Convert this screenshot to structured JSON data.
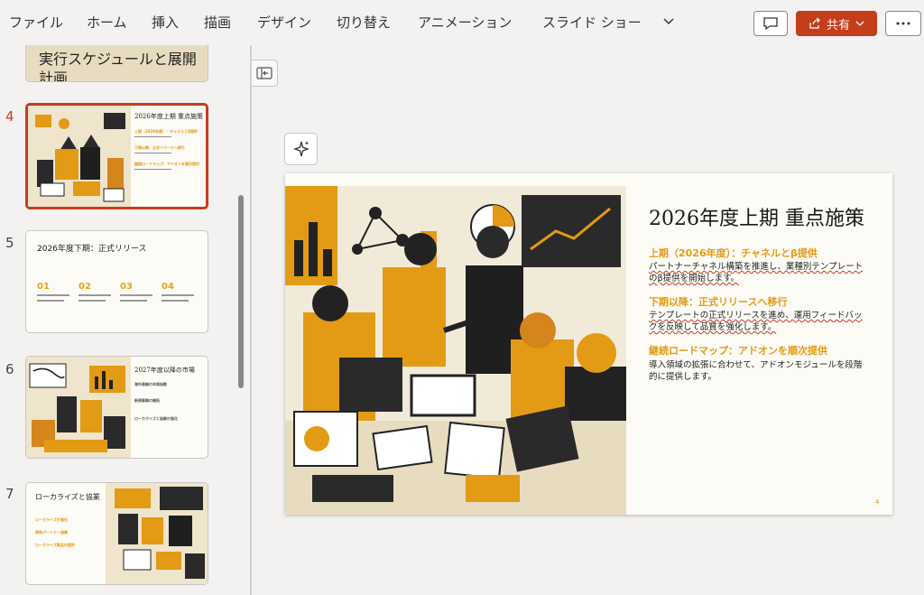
{
  "ribbon": {
    "tabs": [
      "ファイル",
      "ホーム",
      "挿入",
      "描画",
      "デザイン",
      "切り替え",
      "アニメーション",
      "スライド ショー"
    ],
    "share_label": "共有",
    "accent": "#c43e1c"
  },
  "panel": {
    "slide3_partial_title": "実行スケジュールと展開計画",
    "thumbs": [
      {
        "number": "4",
        "title": "2026年度上期 重点施策",
        "heads": [
          "上期（2026年度）：チャネルとβ提供",
          "下期以降：正式リリースへ移行",
          "継続ロードマップ：アドオンを順次提供"
        ]
      },
      {
        "number": "5",
        "title": "2026年度下期：正式リリース",
        "steps": [
          "01",
          "02",
          "03",
          "04"
        ]
      },
      {
        "number": "6",
        "title": "2027年度以降の市場",
        "lines": [
          "海外展開の本格始動",
          "新規事業の開拓",
          "ローカライズと協業の強化"
        ]
      },
      {
        "number": "7",
        "title": "ローカライズと協業",
        "lines": [
          "ローカライズの強化",
          "現地パートナー協業",
          "ローカライズ製品の提供"
        ]
      }
    ]
  },
  "slide": {
    "title": "2026年度上期 重点施策",
    "sections": [
      {
        "head": "上期（2026年度）：チャネルとβ提供",
        "body": "パートナーチャネル構築を推進し、業種別テンプレートのβ提供を開始します。"
      },
      {
        "head": "下期以降：正式リリースへ移行",
        "body": "テンプレートの正式リリースを進め、運用フィードバックを反映して品質を強化します。"
      },
      {
        "head": "継続ロードマップ：アドオンを順次提供",
        "body": "導入領域の拡張に合わせて、アドオンモジュールを段階的に提供します。"
      }
    ],
    "page_number": "4"
  },
  "colors": {
    "accent_orange": "#e39a14",
    "selection": "#c43e1c"
  },
  "icons": [
    "chevron-down-icon",
    "comment-icon",
    "share-icon",
    "more-icon",
    "collapse-panel-icon",
    "designer-sparkle-icon"
  ]
}
